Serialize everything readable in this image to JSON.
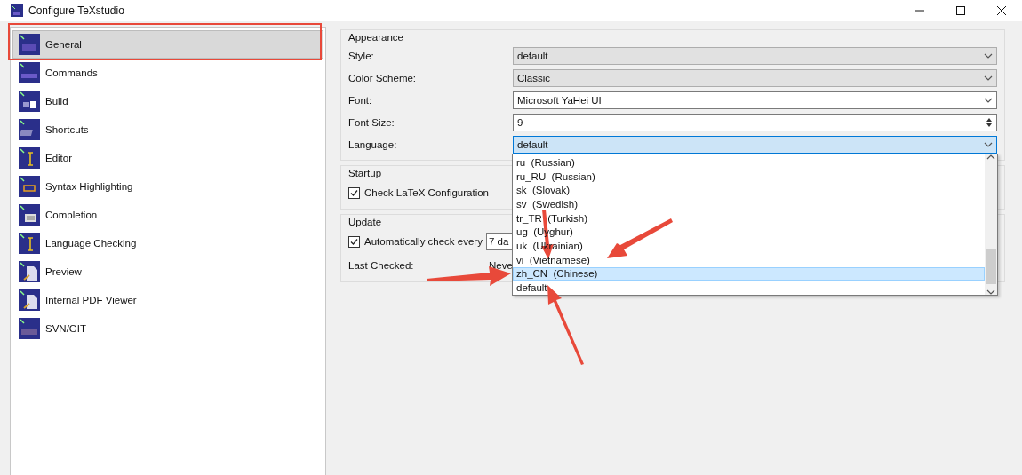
{
  "window": {
    "title": "Configure TeXstudio"
  },
  "sidebar": {
    "items": [
      {
        "label": "General",
        "selected": true
      },
      {
        "label": "Commands",
        "selected": false
      },
      {
        "label": "Build",
        "selected": false
      },
      {
        "label": "Shortcuts",
        "selected": false
      },
      {
        "label": "Editor",
        "selected": false
      },
      {
        "label": "Syntax Highlighting",
        "selected": false
      },
      {
        "label": "Completion",
        "selected": false
      },
      {
        "label": "Language Checking",
        "selected": false
      },
      {
        "label": "Preview",
        "selected": false
      },
      {
        "label": "Internal PDF Viewer",
        "selected": false
      },
      {
        "label": "SVN/GIT",
        "selected": false
      }
    ]
  },
  "appearance": {
    "title": "Appearance",
    "fields": [
      {
        "label": "Style:",
        "kind": "dropdown",
        "value": "default",
        "open": false
      },
      {
        "label": "Color Scheme:",
        "kind": "dropdown",
        "value": "Classic",
        "open": false
      },
      {
        "label": "Font:",
        "kind": "editable",
        "value": "Microsoft YaHei UI",
        "open": false
      },
      {
        "label": "Font Size:",
        "kind": "spinbox",
        "value": "9",
        "open": false
      },
      {
        "label": "Language:",
        "kind": "dropdown",
        "value": "default",
        "open": true
      }
    ]
  },
  "startup": {
    "title": "Startup",
    "option": {
      "label": "Check LaTeX Configuration",
      "checked": true
    }
  },
  "update": {
    "title": "Update",
    "auto_check": {
      "label": "Automatically check every",
      "checked": true,
      "interval": "7 da"
    },
    "last_checked": {
      "label": "Last Checked:",
      "value": "Neve"
    }
  },
  "language_popup": {
    "options": [
      {
        "label": "ru  (Russian)",
        "selected": false
      },
      {
        "label": "ru_RU  (Russian)",
        "selected": false
      },
      {
        "label": "sk  (Slovak)",
        "selected": false
      },
      {
        "label": "sv  (Swedish)",
        "selected": false
      },
      {
        "label": "tr_TR  (Turkish)",
        "selected": false
      },
      {
        "label": "ug  (Uyghur)",
        "selected": false
      },
      {
        "label": "uk  (Ukrainian)",
        "selected": false
      },
      {
        "label": "vi  (Vietnamese)",
        "selected": false
      },
      {
        "label": "zh_CN  (Chinese)",
        "selected": true
      },
      {
        "label": "default",
        "selected": false
      }
    ]
  }
}
